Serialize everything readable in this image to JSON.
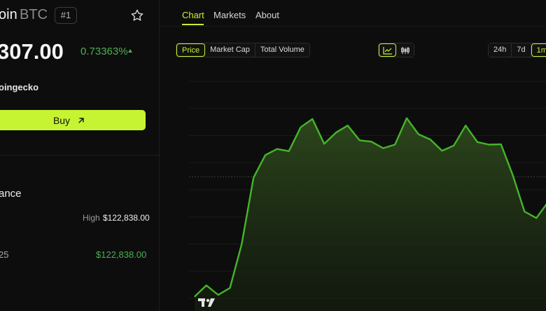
{
  "coin": {
    "name_fragment": "oin",
    "symbol": "BTC",
    "rank": "#1",
    "price": "307.00",
    "change": "0.73363%",
    "source": "oingecko"
  },
  "actions": {
    "buy_label": "Buy"
  },
  "performance": {
    "heading": "ance",
    "high_label": "High",
    "high_value": "$122,838.00",
    "ath_label": "25",
    "ath_value": "$122,838.00"
  },
  "tabs": [
    {
      "label": "Chart",
      "active": true
    },
    {
      "label": "Markets",
      "active": false
    },
    {
      "label": "About",
      "active": false
    }
  ],
  "metric_toggle": [
    {
      "label": "Price",
      "active": true
    },
    {
      "label": "Market Cap",
      "active": false
    },
    {
      "label": "Total Volume",
      "active": false
    }
  ],
  "chart_type_toggle": [
    {
      "icon": "line-chart-icon",
      "active": true
    },
    {
      "icon": "candlestick-icon",
      "active": false
    }
  ],
  "range_toggle": [
    {
      "label": "24h",
      "active": false
    },
    {
      "label": "7d",
      "active": false
    },
    {
      "label": "1m",
      "active": true
    }
  ],
  "colors": {
    "accent": "#c6f432",
    "up": "#4caf50",
    "background": "#0d0d0d"
  },
  "chart_data": {
    "type": "area",
    "series": [
      {
        "values": [
          4,
          30,
          8,
          24,
          125,
          278,
          330,
          344,
          339,
          394,
          413,
          356,
          382,
          398,
          364,
          361,
          346,
          354,
          415,
          378,
          366,
          340,
          352,
          398,
          360,
          354,
          355,
          284,
          200,
          185,
          222
        ]
      }
    ],
    "ylim": [
      0,
      500
    ],
    "grid": true,
    "reference_line": 280,
    "legend": "none"
  }
}
